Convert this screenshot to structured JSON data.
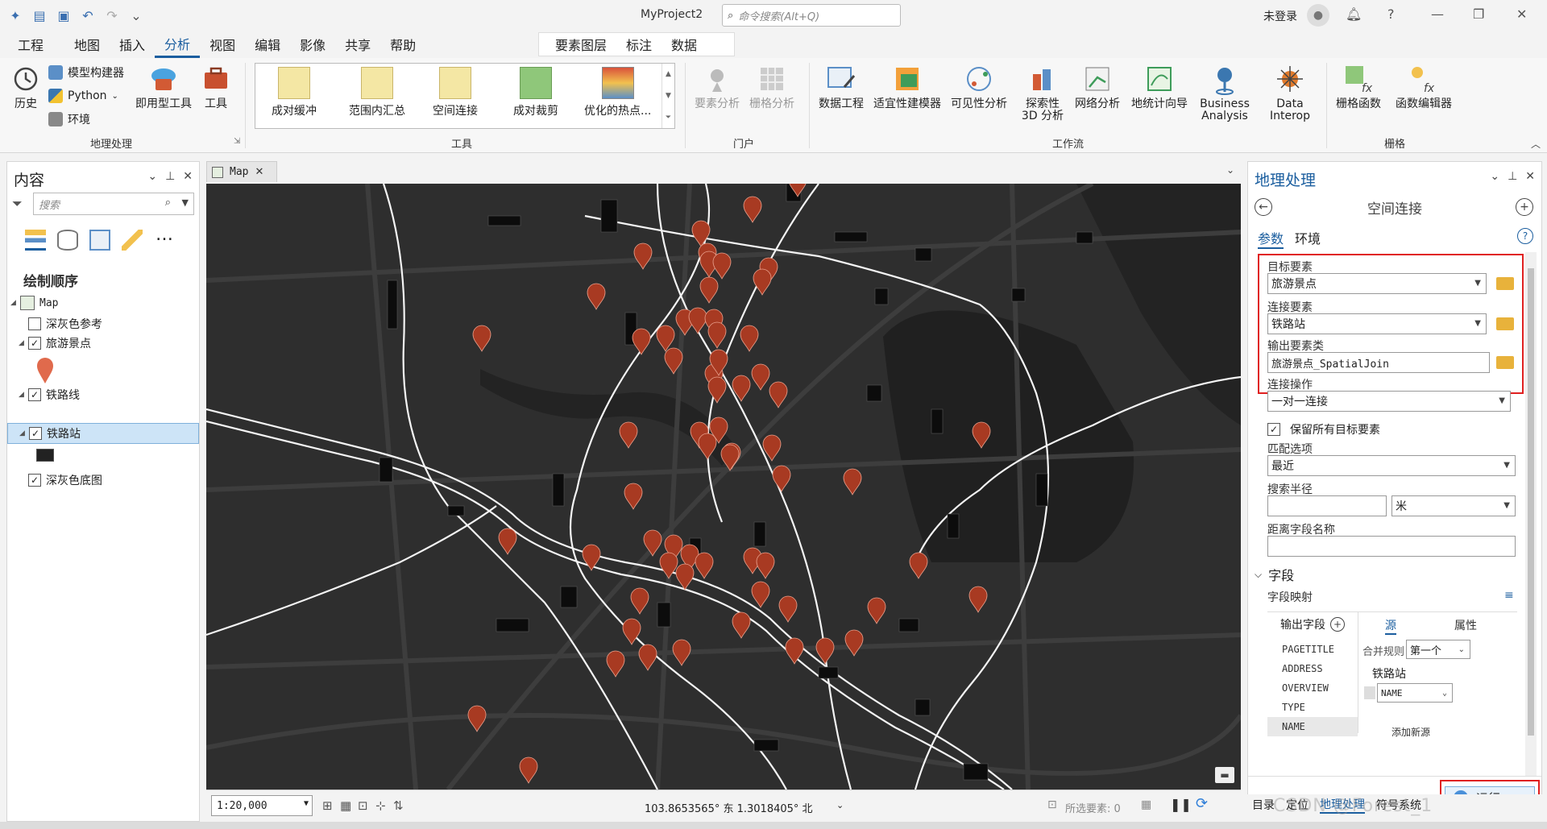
{
  "app": {
    "project_title": "MyProject2",
    "command_search_placeholder": "命令搜索(Alt+Q)",
    "login_text": "未登录"
  },
  "ribbon_tabs": [
    "工程",
    "地图",
    "插入",
    "分析",
    "视图",
    "编辑",
    "影像",
    "共享",
    "帮助"
  ],
  "active_tab": "分析",
  "context_tabs": [
    "要素图层",
    "标注",
    "数据"
  ],
  "ribbon": {
    "geoprocessing": {
      "history_label": "历史",
      "model_builder_label": "模型构建器",
      "python_label": "Python",
      "environments_label": "环境",
      "ready_tools_label": "即用型工具",
      "tools_label": "工具",
      "group_label": "地理处理"
    },
    "tools_gallery": {
      "items": [
        "成对缓冲",
        "范围内汇总",
        "空间连接",
        "成对裁剪",
        "优化的热点..."
      ],
      "group_label": "工具"
    },
    "portal": {
      "feature_analysis_label": "要素分析",
      "raster_analysis_label": "栅格分析",
      "group_label": "门户"
    },
    "workflows": {
      "items": [
        "数据工程",
        "适宜性建模器",
        "可见性分析",
        "探索性 3D 分析",
        "网络分析",
        "地统计向导",
        "Business Analysis",
        "Data Interop"
      ],
      "group_label": "工作流"
    },
    "raster": {
      "items": [
        "栅格函数",
        "函数编辑器"
      ],
      "group_label": "栅格"
    }
  },
  "contents_pane": {
    "title": "内容",
    "search_placeholder": "搜索",
    "drawing_order_label": "绘制顺序",
    "layers": [
      {
        "name": "Map",
        "type": "map"
      },
      {
        "name": "深灰色参考",
        "checked": false
      },
      {
        "name": "旅游景点",
        "checked": true
      },
      {
        "name": "铁路线",
        "checked": true
      },
      {
        "name": "铁路站",
        "checked": true,
        "selected": true
      },
      {
        "name": "深灰色底图",
        "checked": true
      }
    ]
  },
  "map_view": {
    "tab_label": "Map",
    "scale": "1:20,000",
    "coordinates": "103.8653565° 东  1.3018405° 北",
    "selected_features": "所选要素: 0"
  },
  "geoprocessing_pane": {
    "title": "地理处理",
    "tool_name": "空间连接",
    "tabs": [
      "参数",
      "环境"
    ],
    "active_tab": "参数",
    "params": {
      "target_features_label": "目标要素",
      "target_features_value": "旅游景点",
      "join_features_label": "连接要素",
      "join_features_value": "铁路站",
      "output_label": "输出要素类",
      "output_value": "旅游景点_SpatialJoin",
      "join_operation_label": "连接操作",
      "join_operation_value": "一对一连接",
      "keep_all_label": "保留所有目标要素",
      "keep_all_checked": true,
      "match_option_label": "匹配选项",
      "match_option_value": "最近",
      "search_radius_label": "搜索半径",
      "search_radius_value": "",
      "search_radius_unit": "米",
      "distance_field_label": "距离字段名称",
      "distance_field_value": ""
    },
    "fields_section": {
      "title": "字段",
      "field_map_label": "字段映射",
      "output_fields_label": "输出字段",
      "source_tab": "源",
      "properties_tab": "属性",
      "fields": [
        "PAGETITLE",
        "ADDRESS",
        "OVERVIEW",
        "TYPE",
        "NAME"
      ],
      "merge_rule_label": "合并规则",
      "merge_rule_value": "第一个",
      "source_layer": "铁路站",
      "source_field": "NAME",
      "add_new_source": "添加新源"
    },
    "run_label": "运行",
    "bottom_tabs": [
      "目录",
      "定位",
      "地理处理",
      "符号系统"
    ],
    "bottom_active": "地理处理"
  },
  "watermark": "CSDN @Forest_1",
  "colors": {
    "accent": "#1b5e9f",
    "marker": "#b5402a",
    "map_bg": "#2b2b2b",
    "highlight_frame": "#e02020"
  }
}
